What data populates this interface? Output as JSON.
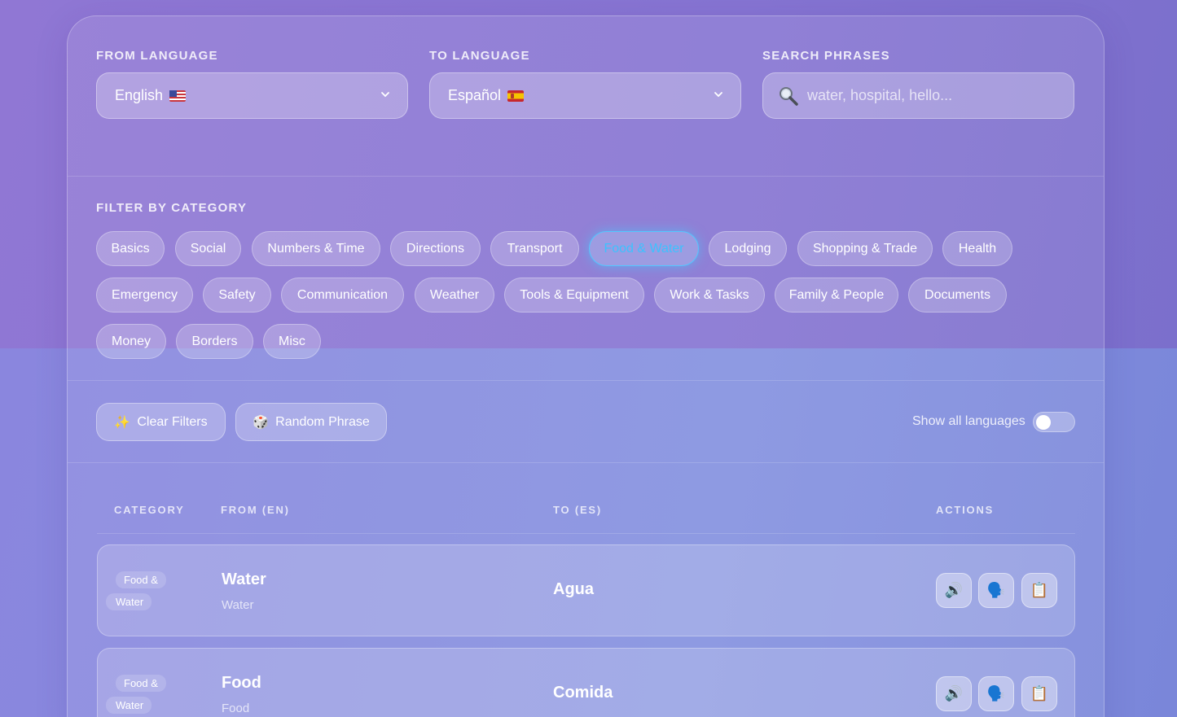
{
  "from_language": {
    "label": "FROM LANGUAGE",
    "value": "English",
    "flag_icon": "us-flag-icon"
  },
  "to_language": {
    "label": "TO LANGUAGE",
    "value": "Español",
    "flag_icon": "spain-flag-icon"
  },
  "search": {
    "label": "SEARCH PHRASES",
    "placeholder": "water, hospital, hello..."
  },
  "filter": {
    "label": "FILTER BY CATEGORY",
    "active": "Food & Water",
    "chips": [
      "Basics",
      "Social",
      "Numbers & Time",
      "Directions",
      "Transport",
      "Food & Water",
      "Lodging",
      "Shopping & Trade",
      "Health",
      "Emergency",
      "Safety",
      "Communication",
      "Weather",
      "Tools & Equipment",
      "Work & Tasks",
      "Family & People",
      "Documents",
      "Money",
      "Borders",
      "Misc"
    ]
  },
  "toolbar": {
    "clear_label": "Clear Filters",
    "clear_icon": "✨",
    "random_label": "Random Phrase",
    "random_icon": "🎲",
    "toggle_label": "Show all languages",
    "toggle_on": false
  },
  "table": {
    "headers": {
      "category": "CATEGORY",
      "from": "FROM (EN)",
      "to": "TO (ES)",
      "actions": "ACTIONS"
    },
    "rows": [
      {
        "category_line1": "Food &",
        "category_line2": "Water",
        "from": "Water",
        "from_sub": "Water",
        "to": "Agua"
      },
      {
        "category_line1": "Food &",
        "category_line2": "Water",
        "from": "Food",
        "from_sub": "Food",
        "to": "Comida"
      }
    ],
    "action_icons": {
      "speak": "🔊",
      "pronounce": "🗣️",
      "copy": "📋"
    }
  },
  "colors": {
    "active_chip": "#3cc2ff",
    "background_top": "#8b74d6",
    "background_bottom": "#8390e0"
  }
}
